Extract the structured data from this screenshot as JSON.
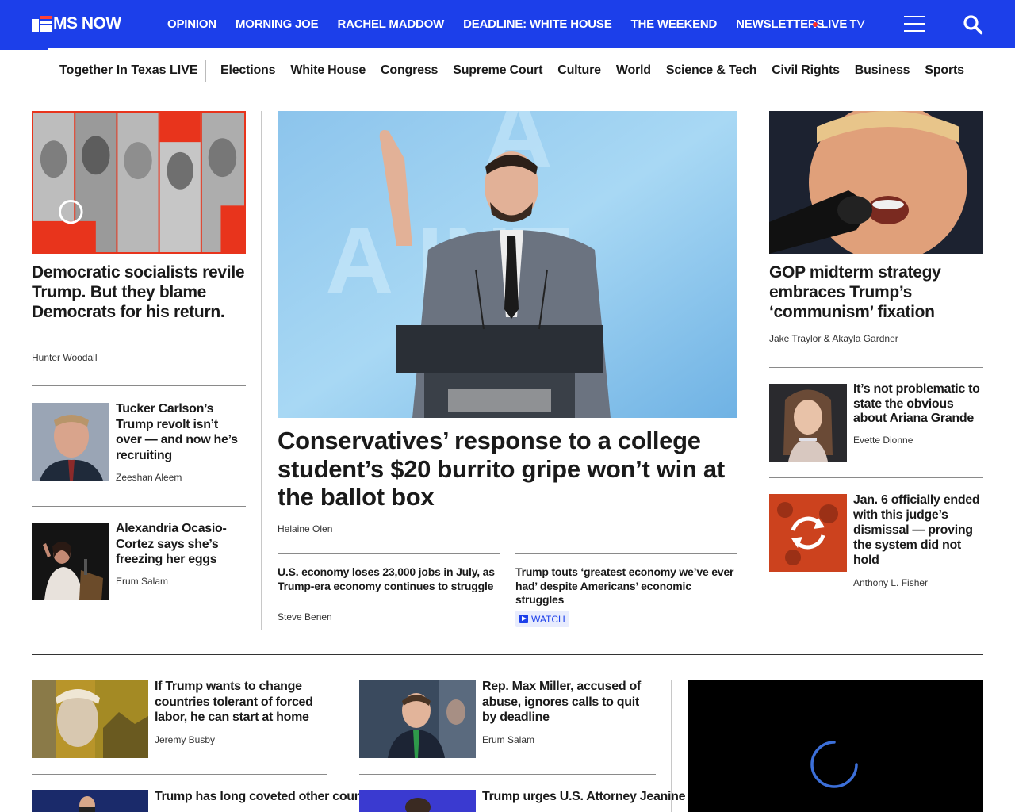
{
  "brand": {
    "name": "MS NOW",
    "accent": "#1c3fea"
  },
  "topnav": [
    "OPINION",
    "MORNING JOE",
    "RACHEL MADDOW",
    "DEADLINE: WHITE HOUSE",
    "THE WEEKEND",
    "NEWSLETTERS"
  ],
  "live": {
    "label": "LIVE",
    "suffix": "TV"
  },
  "subnav": {
    "featured": "Together In Texas LIVE",
    "items": [
      "Elections",
      "White House",
      "Congress",
      "Supreme Court",
      "Culture",
      "World",
      "Science & Tech",
      "Civil Rights",
      "Business",
      "Sports"
    ]
  },
  "left_col": {
    "lead": {
      "headline": "Democratic socialists revile Trump. But they blame Democrats for his return.",
      "byline": "Hunter Woodall"
    },
    "items": [
      {
        "headline": "Tucker Carlson’s Trump revolt isn’t over — and now he’s recruiting",
        "byline": "Zeeshan Aleem"
      },
      {
        "headline": "Alexandria Ocasio-Cortez says she’s freezing her eggs",
        "byline": "Erum Salam"
      }
    ]
  },
  "center_col": {
    "lead": {
      "headline": "Conservatives’ response to a college student’s $20 burrito gripe won’t win at the ballot box",
      "byline": "Helaine Olen"
    },
    "sub": [
      {
        "headline": "U.S. economy loses 23,000 jobs in July, as Trump-era economy continues to struggle",
        "byline": "Steve Benen"
      },
      {
        "headline": "Trump touts ‘greatest economy we’ve ever had’ despite Americans’ economic struggles",
        "badge": "WATCH"
      }
    ]
  },
  "right_col": {
    "lead": {
      "headline": "GOP midterm strategy embraces Trump’s ‘communism’ fixation",
      "byline": "Jake Traylor & Akayla Gardner"
    },
    "items": [
      {
        "headline": "It’s not problematic to state the obvious about Ariana Grande",
        "byline": "Evette Dionne"
      },
      {
        "headline": "Jan. 6 officially ended with this judge’s dismissal — proving the system did not hold",
        "byline": "Anthony L. Fisher"
      }
    ]
  },
  "bottom": {
    "col1": [
      {
        "headline": "If Trump wants to change countries tolerant of forced labor, he can start at home",
        "byline": "Jeremy Busby"
      },
      {
        "headline": "Trump has long coveted other countries’ oil. It’s"
      }
    ],
    "col2": [
      {
        "headline": "Rep. Max Miller, accused of abuse, ignores calls to quit by deadline",
        "byline": "Erum Salam"
      },
      {
        "headline": "Trump urges U.S. Attorney Jeanine Pirro to ‘revisit’"
      }
    ]
  }
}
